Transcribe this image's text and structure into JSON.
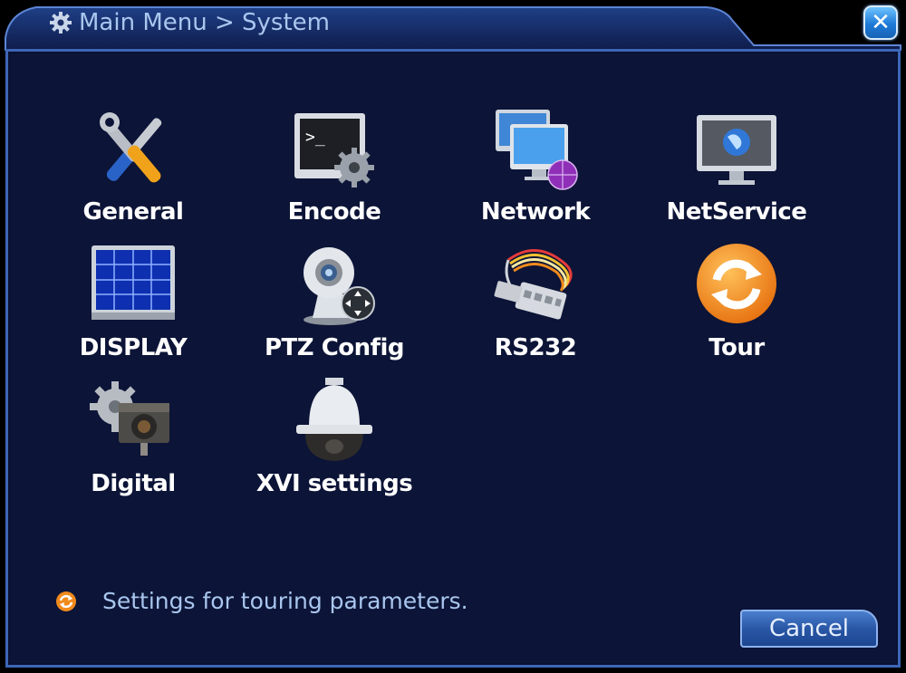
{
  "window": {
    "title": "Main Menu > System",
    "close_label": "✕"
  },
  "tiles": [
    {
      "label": "General",
      "icon": "wrench-screwdriver-icon"
    },
    {
      "label": "Encode",
      "icon": "terminal-gear-icon"
    },
    {
      "label": "Network",
      "icon": "network-monitors-icon"
    },
    {
      "label": "NetService",
      "icon": "monitor-globe-icon"
    },
    {
      "label": "DISPLAY",
      "icon": "display-grid-icon"
    },
    {
      "label": "PTZ Config",
      "icon": "ptz-camera-icon"
    },
    {
      "label": "RS232",
      "icon": "serial-cable-icon"
    },
    {
      "label": "Tour",
      "icon": "refresh-circle-icon"
    },
    {
      "label": "Digital",
      "icon": "camera-gear-icon"
    },
    {
      "label": "XVI settings",
      "icon": "dome-camera-icon"
    }
  ],
  "status": {
    "text": "Settings for touring parameters.",
    "icon": "refresh-circle-icon"
  },
  "footer": {
    "cancel_label": "Cancel"
  },
  "colors": {
    "panel_bg": "#0c1437",
    "border": "#3d66b8",
    "title_text": "#a9c6ee",
    "label_text": "#ffffff",
    "accent_orange": "#f08a1c"
  }
}
